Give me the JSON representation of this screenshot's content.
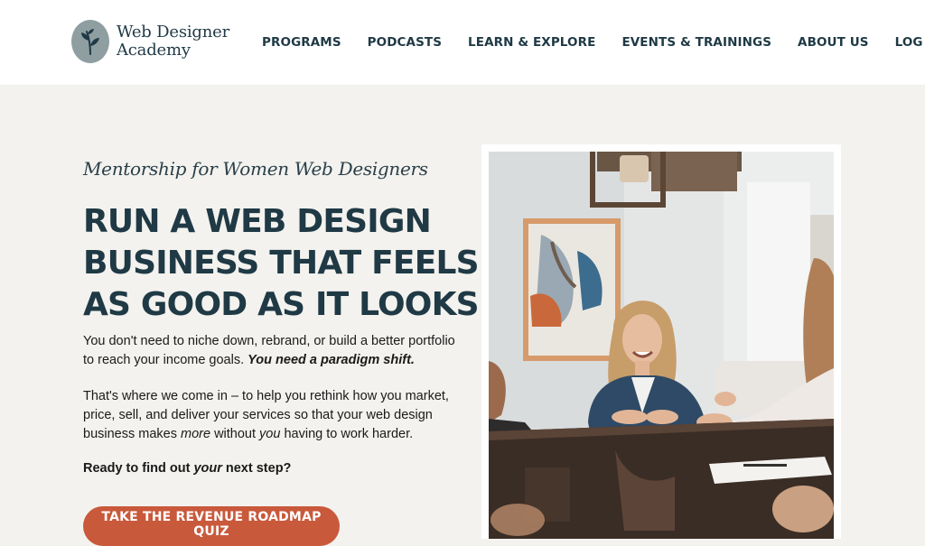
{
  "header": {
    "logo_line1": "Web Designer",
    "logo_line2": "Academy",
    "logo_icon": "leaf-sprig-icon",
    "nav": [
      {
        "label": "PROGRAMS"
      },
      {
        "label": "PODCASTS"
      },
      {
        "label": "LEARN & EXPLORE"
      },
      {
        "label": "EVENTS & TRAININGS"
      },
      {
        "label": "ABOUT US"
      },
      {
        "label": "LOG IN"
      }
    ]
  },
  "hero": {
    "eyebrow": "Mentorship for Women Web Designers",
    "headline_lines": [
      "RUN A WEB DESIGN",
      "BUSINESS THAT FEELS",
      "AS GOOD AS IT LOOKS"
    ],
    "p1_text": "You don't need to niche down, rebrand, or build a better portfolio to reach your income goals. ",
    "p1_emphasis": "You need a paradigm shift.",
    "p2_before": "That's where we come in – to help you rethink how you market, price, sell, and deliver your services so that your web design business makes ",
    "p2_em1": "more",
    "p2_middle": " without ",
    "p2_em2": "you",
    "p2_after": " having to work harder.",
    "p3_before": "Ready to find out ",
    "p3_em": "your",
    "p3_after": " next step?",
    "cta_label": "TAKE THE REVENUE ROADMAP QUIZ"
  },
  "colors": {
    "brand_navy": "#1f3945",
    "cta": "#c9593b",
    "page_bg": "#f3f2ee",
    "logo_badge": "#8e9ea1"
  }
}
